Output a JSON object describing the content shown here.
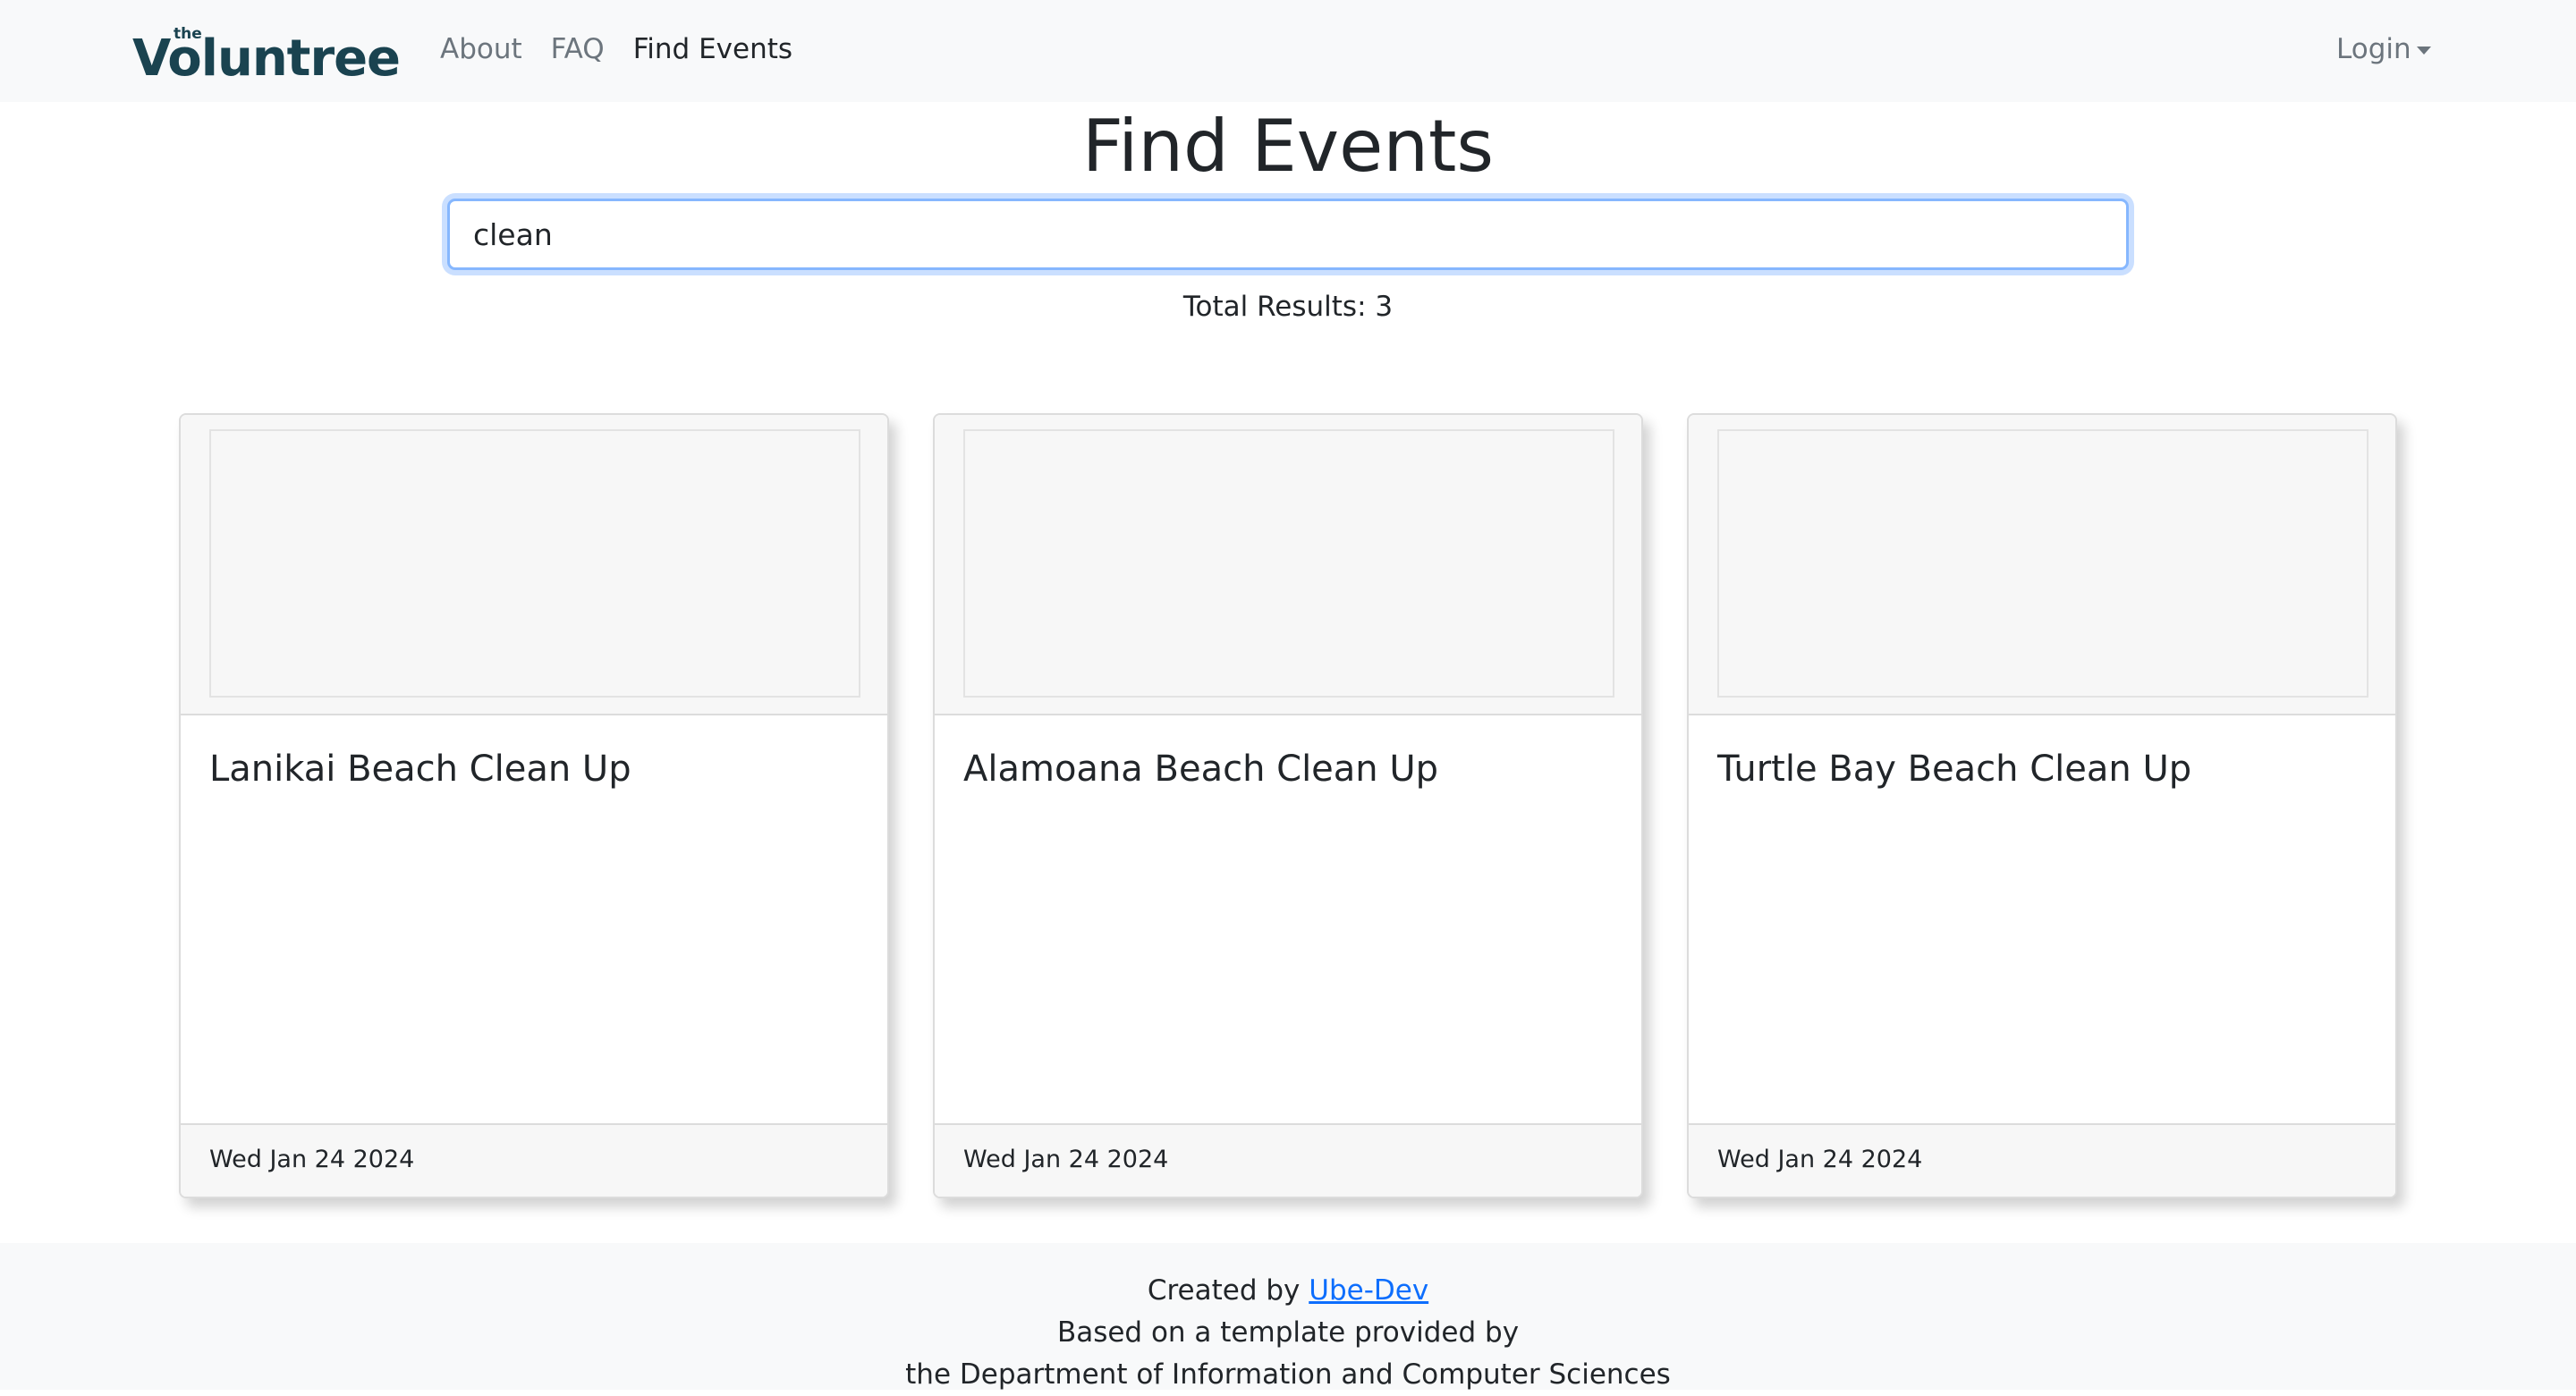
{
  "navbar": {
    "brand_small": "the",
    "brand_name": "Voluntree",
    "links": [
      {
        "label": "About"
      },
      {
        "label": "FAQ"
      },
      {
        "label": "Find Events"
      }
    ],
    "login_label": "Login"
  },
  "search": {
    "title": "Find Events",
    "query": "clean",
    "total_results": "Total Results: 3"
  },
  "events": [
    {
      "title": "Lanikai Beach Clean Up",
      "date": "Wed Jan 24 2024"
    },
    {
      "title": "Alamoana Beach Clean Up",
      "date": "Wed Jan 24 2024"
    },
    {
      "title": "Turtle Bay Beach Clean Up",
      "date": "Wed Jan 24 2024"
    }
  ],
  "footer": {
    "created_by": "Created by",
    "author_link": "Ube-Dev",
    "line2": "Based on a template provided by",
    "line3": "the Department of Information and Computer Sciences"
  },
  "colors": {
    "brand": "#1a4350",
    "link": "#0d6efd",
    "navbar_bg": "#f8f9fa",
    "focus_border": "#86b7fe"
  }
}
